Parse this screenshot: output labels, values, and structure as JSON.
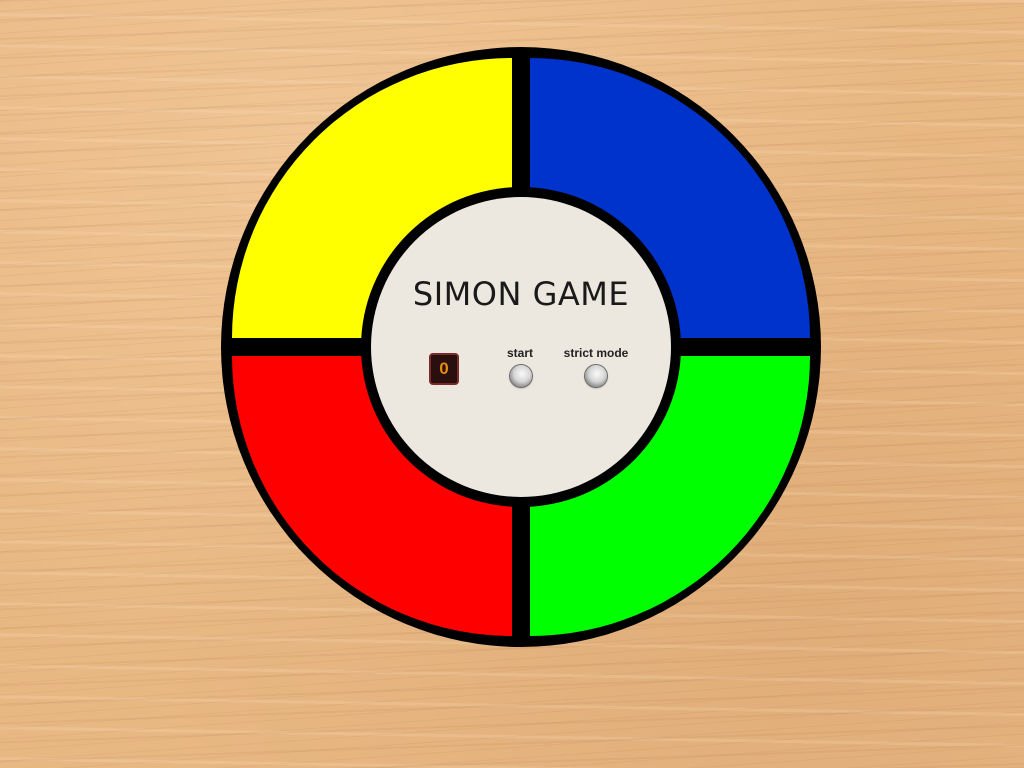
{
  "game": {
    "title": "SIMON GAME",
    "count_display": "0",
    "start_label": "start",
    "strict_label": "strict mode"
  },
  "pads": [
    {
      "name": "yellow",
      "color": "#ffff00"
    },
    {
      "name": "blue",
      "color": "#0033cc"
    },
    {
      "name": "red",
      "color": "#ff0000"
    },
    {
      "name": "green",
      "color": "#00ff00"
    }
  ]
}
